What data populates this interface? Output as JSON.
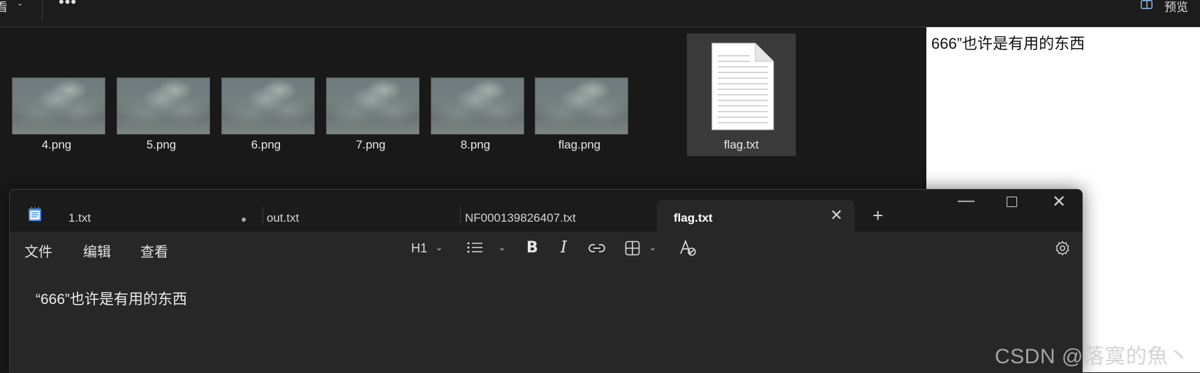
{
  "explorer": {
    "toolbar": {
      "view_menu": "看",
      "view_chevron": "⌄",
      "more": "•••",
      "preview_label": "预览"
    },
    "files": [
      {
        "name": "4.png"
      },
      {
        "name": "5.png"
      },
      {
        "name": "6.png"
      },
      {
        "name": "7.png"
      },
      {
        "name": "8.png"
      },
      {
        "name": "flag.png"
      },
      {
        "name": "flag.txt"
      }
    ],
    "preview_text": "666”也许是有用的东西"
  },
  "notepad": {
    "tabs": [
      {
        "label": "1.txt",
        "unsaved_dot": "●"
      },
      {
        "label": "out.txt"
      },
      {
        "label": "NF000139826407.txt"
      },
      {
        "label": "flag.txt",
        "close": "✕"
      }
    ],
    "new_tab": "+",
    "window_controls": {
      "minimize": "—",
      "close": "✕"
    },
    "menu": {
      "file": "文件",
      "edit": "编辑",
      "view": "查看"
    },
    "format_bar": {
      "heading": "H1",
      "bold": "B",
      "italic": "I",
      "chevron": "⌄"
    },
    "content": "“666”也许是有用的东西"
  },
  "watermark": "CSDN @落寞的魚丶",
  "colors": {
    "explorer_bg": "#191919",
    "notepad_bg": "#272727",
    "titlebar_bg": "#1b1b1b",
    "preview_bg": "#ffffff"
  }
}
